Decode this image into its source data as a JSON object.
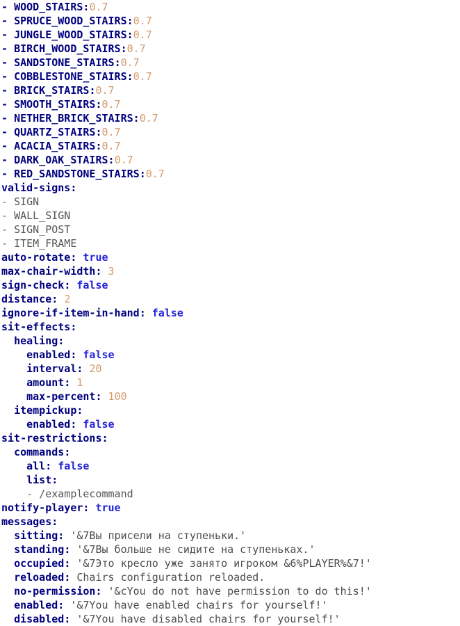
{
  "document": {
    "type": "yaml-configuration",
    "filename_hint": "chairs config",
    "background_color": "#ffffff",
    "colors": {
      "key": "#00007f",
      "boolean": "#2424d8",
      "number": "#d49a6a",
      "string": "#4c4c4c",
      "plain_scalar": "#555555"
    },
    "lines": [
      {
        "indent": 0,
        "dash": true,
        "key": "WOOD_STAIRS",
        "colon": true,
        "value": "0.7",
        "value_type": "number",
        "space_after_colon": false
      },
      {
        "indent": 0,
        "dash": true,
        "key": "SPRUCE_WOOD_STAIRS",
        "colon": true,
        "value": "0.7",
        "value_type": "number",
        "space_after_colon": false
      },
      {
        "indent": 0,
        "dash": true,
        "key": "JUNGLE_WOOD_STAIRS",
        "colon": true,
        "value": "0.7",
        "value_type": "number",
        "space_after_colon": false
      },
      {
        "indent": 0,
        "dash": true,
        "key": "BIRCH_WOOD_STAIRS",
        "colon": true,
        "value": "0.7",
        "value_type": "number",
        "space_after_colon": false
      },
      {
        "indent": 0,
        "dash": true,
        "key": "SANDSTONE_STAIRS",
        "colon": true,
        "value": "0.7",
        "value_type": "number",
        "space_after_colon": false
      },
      {
        "indent": 0,
        "dash": true,
        "key": "COBBLESTONE_STAIRS",
        "colon": true,
        "value": "0.7",
        "value_type": "number",
        "space_after_colon": false
      },
      {
        "indent": 0,
        "dash": true,
        "key": "BRICK_STAIRS",
        "colon": true,
        "value": "0.7",
        "value_type": "number",
        "space_after_colon": false
      },
      {
        "indent": 0,
        "dash": true,
        "key": "SMOOTH_STAIRS",
        "colon": true,
        "value": "0.7",
        "value_type": "number",
        "space_after_colon": false
      },
      {
        "indent": 0,
        "dash": true,
        "key": "NETHER_BRICK_STAIRS",
        "colon": true,
        "value": "0.7",
        "value_type": "number",
        "space_after_colon": false
      },
      {
        "indent": 0,
        "dash": true,
        "key": "QUARTZ_STAIRS",
        "colon": true,
        "value": "0.7",
        "value_type": "number",
        "space_after_colon": false
      },
      {
        "indent": 0,
        "dash": true,
        "key": "ACACIA_STAIRS",
        "colon": true,
        "value": "0.7",
        "value_type": "number",
        "space_after_colon": false
      },
      {
        "indent": 0,
        "dash": true,
        "key": "DARK_OAK_STAIRS",
        "colon": true,
        "value": "0.7",
        "value_type": "number",
        "space_after_colon": false
      },
      {
        "indent": 0,
        "dash": true,
        "key": "RED_SANDSTONE_STAIRS",
        "colon": true,
        "value": "0.7",
        "value_type": "number",
        "space_after_colon": false
      },
      {
        "indent": 0,
        "dash": false,
        "key": "valid-signs",
        "colon": true,
        "value": "",
        "value_type": "none",
        "space_after_colon": false
      },
      {
        "indent": 0,
        "dash": true,
        "key": "",
        "colon": false,
        "value": "SIGN",
        "value_type": "plain",
        "space_after_colon": false
      },
      {
        "indent": 0,
        "dash": true,
        "key": "",
        "colon": false,
        "value": "WALL_SIGN",
        "value_type": "plain",
        "space_after_colon": false
      },
      {
        "indent": 0,
        "dash": true,
        "key": "",
        "colon": false,
        "value": "SIGN_POST",
        "value_type": "plain",
        "space_after_colon": false
      },
      {
        "indent": 0,
        "dash": true,
        "key": "",
        "colon": false,
        "value": "ITEM_FRAME",
        "value_type": "plain",
        "space_after_colon": false
      },
      {
        "indent": 0,
        "dash": false,
        "key": "auto-rotate",
        "colon": true,
        "value": "true",
        "value_type": "boolean",
        "space_after_colon": true
      },
      {
        "indent": 0,
        "dash": false,
        "key": "max-chair-width",
        "colon": true,
        "value": "3",
        "value_type": "number",
        "space_after_colon": true
      },
      {
        "indent": 0,
        "dash": false,
        "key": "sign-check",
        "colon": true,
        "value": "false",
        "value_type": "boolean",
        "space_after_colon": true
      },
      {
        "indent": 0,
        "dash": false,
        "key": "distance",
        "colon": true,
        "value": "2",
        "value_type": "number",
        "space_after_colon": true
      },
      {
        "indent": 0,
        "dash": false,
        "key": "ignore-if-item-in-hand",
        "colon": true,
        "value": "false",
        "value_type": "boolean",
        "space_after_colon": true
      },
      {
        "indent": 0,
        "dash": false,
        "key": "sit-effects",
        "colon": true,
        "value": "",
        "value_type": "none",
        "space_after_colon": false
      },
      {
        "indent": 2,
        "dash": false,
        "key": "healing",
        "colon": true,
        "value": "",
        "value_type": "none",
        "space_after_colon": false
      },
      {
        "indent": 4,
        "dash": false,
        "key": "enabled",
        "colon": true,
        "value": "false",
        "value_type": "boolean",
        "space_after_colon": true
      },
      {
        "indent": 4,
        "dash": false,
        "key": "interval",
        "colon": true,
        "value": "20",
        "value_type": "number",
        "space_after_colon": true
      },
      {
        "indent": 4,
        "dash": false,
        "key": "amount",
        "colon": true,
        "value": "1",
        "value_type": "number",
        "space_after_colon": true
      },
      {
        "indent": 4,
        "dash": false,
        "key": "max-percent",
        "colon": true,
        "value": "100",
        "value_type": "number",
        "space_after_colon": true
      },
      {
        "indent": 2,
        "dash": false,
        "key": "itempickup",
        "colon": true,
        "value": "",
        "value_type": "none",
        "space_after_colon": false
      },
      {
        "indent": 4,
        "dash": false,
        "key": "enabled",
        "colon": true,
        "value": "false",
        "value_type": "boolean",
        "space_after_colon": true
      },
      {
        "indent": 0,
        "dash": false,
        "key": "sit-restrictions",
        "colon": true,
        "value": "",
        "value_type": "none",
        "space_after_colon": false
      },
      {
        "indent": 2,
        "dash": false,
        "key": "commands",
        "colon": true,
        "value": "",
        "value_type": "none",
        "space_after_colon": false
      },
      {
        "indent": 4,
        "dash": false,
        "key": "all",
        "colon": true,
        "value": "false",
        "value_type": "boolean",
        "space_after_colon": true
      },
      {
        "indent": 4,
        "dash": false,
        "key": "list",
        "colon": true,
        "value": "",
        "value_type": "none",
        "space_after_colon": false
      },
      {
        "indent": 4,
        "dash": true,
        "key": "",
        "colon": false,
        "value": "/examplecommand",
        "value_type": "plain",
        "space_after_colon": false
      },
      {
        "indent": 0,
        "dash": false,
        "key": "notify-player",
        "colon": true,
        "value": "true",
        "value_type": "boolean",
        "space_after_colon": true
      },
      {
        "indent": 0,
        "dash": false,
        "key": "messages",
        "colon": true,
        "value": "",
        "value_type": "none",
        "space_after_colon": false
      },
      {
        "indent": 2,
        "dash": false,
        "key": "sitting",
        "colon": true,
        "value": "'&7Вы присели на ступеньки.'",
        "value_type": "string",
        "space_after_colon": true
      },
      {
        "indent": 2,
        "dash": false,
        "key": "standing",
        "colon": true,
        "value": "'&7Вы больше не сидите на ступеньках.'",
        "value_type": "string",
        "space_after_colon": true
      },
      {
        "indent": 2,
        "dash": false,
        "key": "occupied",
        "colon": true,
        "value": "'&7Это кресло уже занято игроком &6%PLAYER%&7!'",
        "value_type": "string",
        "space_after_colon": true
      },
      {
        "indent": 2,
        "dash": false,
        "key": "reloaded",
        "colon": true,
        "value": "Chairs configuration reloaded.",
        "value_type": "string",
        "space_after_colon": true
      },
      {
        "indent": 2,
        "dash": false,
        "key": "no-permission",
        "colon": true,
        "value": "'&cYou do not have permission to do this!'",
        "value_type": "string",
        "space_after_colon": true
      },
      {
        "indent": 2,
        "dash": false,
        "key": "enabled",
        "colon": true,
        "value": "'&7You have enabled chairs for yourself!'",
        "value_type": "string",
        "space_after_colon": true
      },
      {
        "indent": 2,
        "dash": false,
        "key": "disabled",
        "colon": true,
        "value": "'&7You have disabled chairs for yourself!'",
        "value_type": "string",
        "space_after_colon": true
      }
    ]
  }
}
